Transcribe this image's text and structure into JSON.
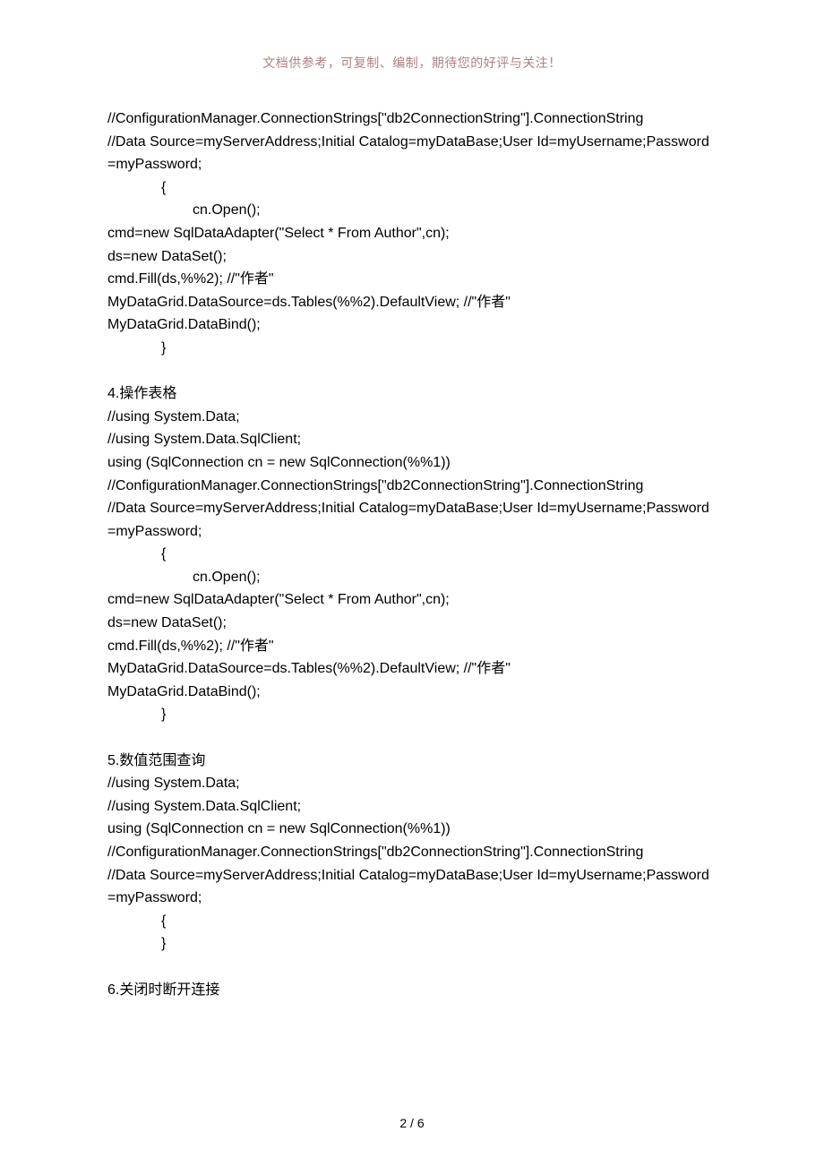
{
  "header": {
    "note": "文档供参考，可复制、编制，期待您的好评与关注！"
  },
  "body": {
    "l1": "//ConfigurationManager.ConnectionStrings[\"db2ConnectionString\"].ConnectionString",
    "l2": "//Data Source=myServerAddress;Initial Catalog=myDataBase;User Id=myUsername;Password=myPassword;",
    "l3": "{",
    "l4": "cn.Open();",
    "l5": "cmd=new SqlDataAdapter(\"Select * From Author\",cn);",
    "l6": "ds=new DataSet();",
    "l7": "cmd.Fill(ds,%%2); //\"作者\"",
    "l8": "MyDataGrid.DataSource=ds.Tables(%%2).DefaultView; //\"作者\"",
    "l9": "MyDataGrid.DataBind();",
    "l10": "}",
    "s4_title": "4.操作表格",
    "s4_l1": "//using System.Data;",
    "s4_l2": "//using System.Data.SqlClient;",
    "s4_l3": "using (SqlConnection cn = new SqlConnection(%%1))",
    "s4_l4": "//ConfigurationManager.ConnectionStrings[\"db2ConnectionString\"].ConnectionString",
    "s4_l5": "//Data Source=myServerAddress;Initial Catalog=myDataBase;User Id=myUsername;Password=myPassword;",
    "s4_l6": "{",
    "s4_l7": "cn.Open();",
    "s4_l8": "cmd=new SqlDataAdapter(\"Select * From Author\",cn);",
    "s4_l9": "ds=new DataSet();",
    "s4_l10": "cmd.Fill(ds,%%2); //\"作者\"",
    "s4_l11": "MyDataGrid.DataSource=ds.Tables(%%2).DefaultView; //\"作者\"",
    "s4_l12": "MyDataGrid.DataBind();",
    "s4_l13": "}",
    "s5_title": "5.数值范围查询",
    "s5_l1": "//using System.Data;",
    "s5_l2": "//using System.Data.SqlClient;",
    "s5_l3": "using (SqlConnection cn = new SqlConnection(%%1))",
    "s5_l4": "//ConfigurationManager.ConnectionStrings[\"db2ConnectionString\"].ConnectionString",
    "s5_l5": "//Data Source=myServerAddress;Initial Catalog=myDataBase;User Id=myUsername;Password=myPassword;",
    "s5_l6": "{",
    "s5_l7": "}",
    "s6_title": "6.关闭时断开连接"
  },
  "footer": {
    "page": "2 / 6"
  }
}
